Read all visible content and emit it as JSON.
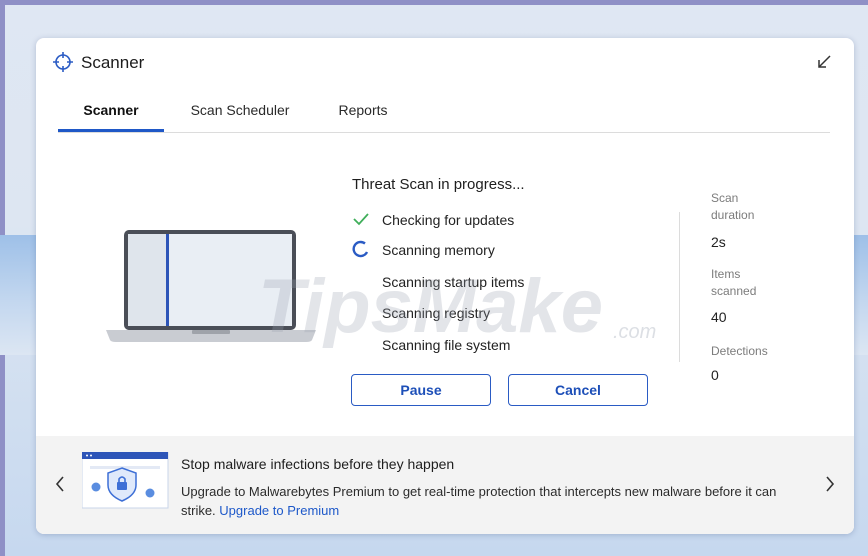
{
  "window": {
    "title": "Scanner"
  },
  "tabs": [
    {
      "label": "Scanner",
      "active": true
    },
    {
      "label": "Scan Scheduler",
      "active": false
    },
    {
      "label": "Reports",
      "active": false
    }
  ],
  "scan": {
    "title": "Threat Scan in progress...",
    "steps": [
      {
        "label": "Checking for updates",
        "status": "done"
      },
      {
        "label": "Scanning memory",
        "status": "in-progress"
      },
      {
        "label": "Scanning startup items",
        "status": "pending"
      },
      {
        "label": "Scanning registry",
        "status": "pending"
      },
      {
        "label": "Scanning file system",
        "status": "pending"
      }
    ],
    "pause_label": "Pause",
    "cancel_label": "Cancel"
  },
  "stats": {
    "duration_label": "Scan duration",
    "duration_value": "2s",
    "items_label": "Items scanned",
    "items_value": "40",
    "detections_label": "Detections",
    "detections_value": "0"
  },
  "promo": {
    "title": "Stop malware infections before they happen",
    "body": "Upgrade to Malwarebytes Premium to get real-time protection that intercepts new malware before it can strike.",
    "link": "Upgrade to Premium"
  },
  "watermark": {
    "main": "TipsMake",
    "suffix": ".com"
  },
  "colors": {
    "accent": "#1f58c7",
    "check": "#3fae5a",
    "promo_bg": "#f3f3f3"
  },
  "icons": {
    "title": "crosshair-icon",
    "minimize": "minimize-arrow-icon",
    "done": "checkmark-icon",
    "progress": "spinner-icon",
    "prev": "chevron-left-icon",
    "next": "chevron-right-icon"
  }
}
